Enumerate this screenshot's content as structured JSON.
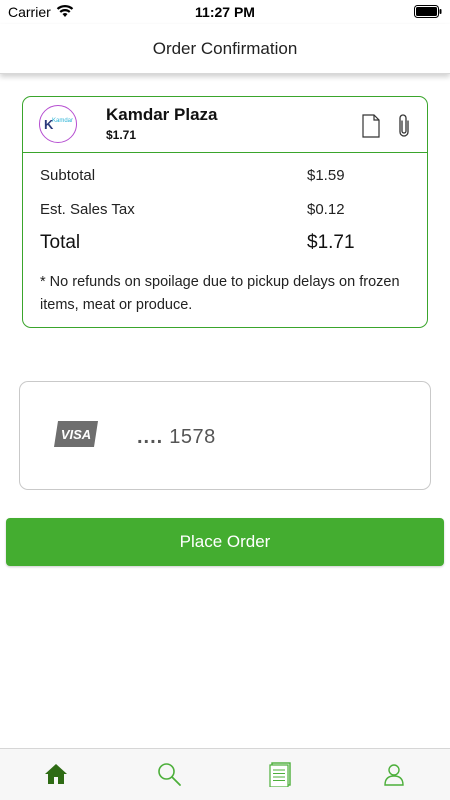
{
  "status_bar": {
    "carrier": "Carrier",
    "time": "11:27 PM"
  },
  "nav": {
    "title": "Order Confirmation"
  },
  "order": {
    "store_name": "Kamdar Plaza",
    "store_total": "$1.71",
    "logo_text": "Kamdar",
    "logo_letter": "K",
    "lines": {
      "subtotal_label": "Subtotal",
      "subtotal_value": "$1.59",
      "tax_label": "Est. Sales Tax",
      "tax_value": "$0.12",
      "total_label": "Total",
      "total_value": "$1.71"
    },
    "note": "* No refunds on spoilage due to pickup delays on frozen items, meat or produce."
  },
  "payment": {
    "brand": "VISA",
    "mask": "....",
    "last4": "1578"
  },
  "actions": {
    "place_order_label": "Place Order"
  },
  "tabs": [
    "home-icon",
    "search-icon",
    "orders-icon",
    "profile-icon"
  ],
  "colors": {
    "accent": "#44ad30",
    "card_border": "#3aa52c",
    "tab_active": "#2e6b14",
    "tab_inactive": "#4caf3a"
  }
}
